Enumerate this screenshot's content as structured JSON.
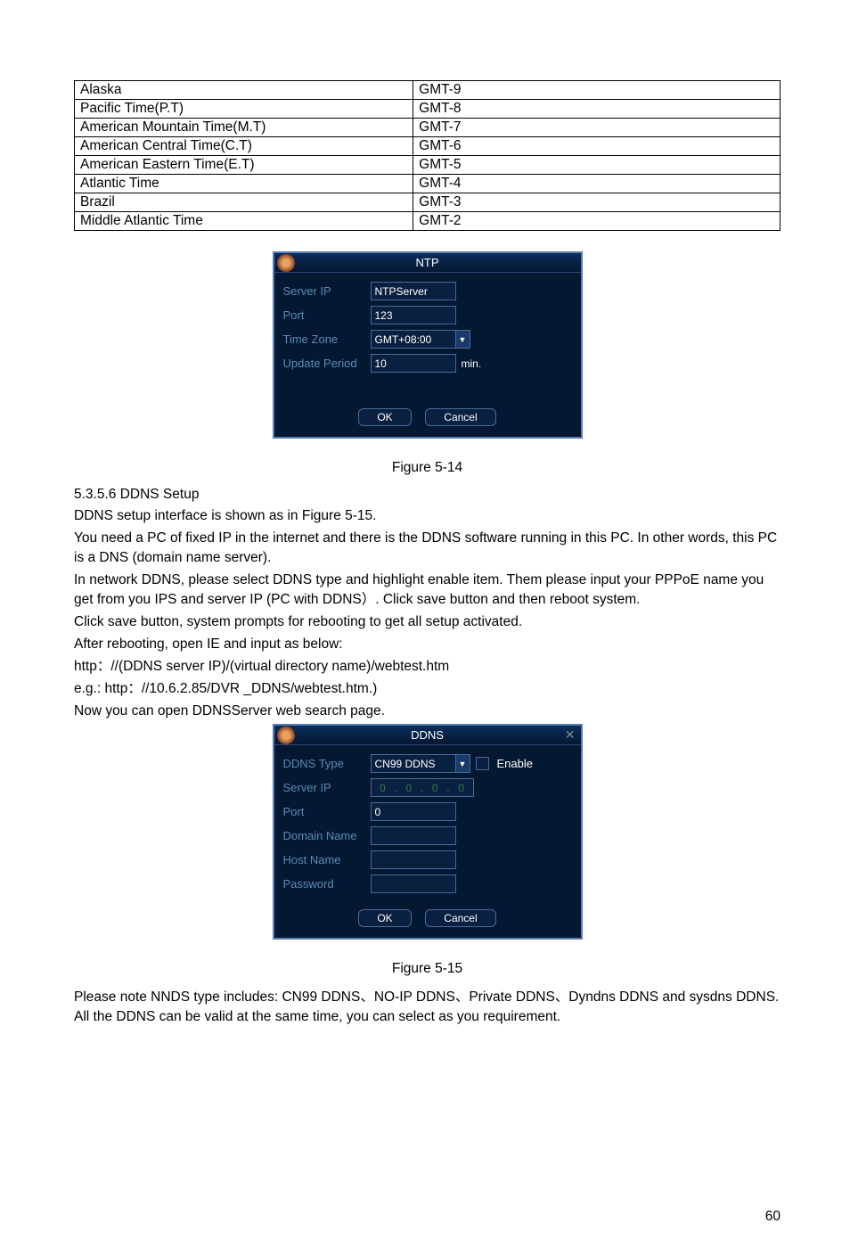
{
  "tz_table": {
    "rows": [
      [
        "Alaska",
        "GMT-9"
      ],
      [
        "Pacific Time(P.T)",
        "GMT-8"
      ],
      [
        "American  Mountain Time(M.T)",
        "GMT-7"
      ],
      [
        "American Central Time(C.T)",
        "GMT-6"
      ],
      [
        "American Eastern Time(E.T)",
        "GMT-5"
      ],
      [
        "Atlantic Time",
        "GMT-4"
      ],
      [
        "Brazil",
        "GMT-3"
      ],
      [
        "Middle Atlantic Time",
        "GMT-2"
      ]
    ]
  },
  "ntp_dialog": {
    "title": "NTP",
    "server_ip_label": "Server IP",
    "server_ip_value": "NTPServer",
    "port_label": "Port",
    "port_value": "123",
    "tz_label": "Time Zone",
    "tz_value": "GMT+08:00",
    "period_label": "Update Period",
    "period_value": "10",
    "period_unit": "min.",
    "ok": "OK",
    "cancel": "Cancel"
  },
  "fig1": "Figure 5-14",
  "section": {
    "heading": "5.3.5.6  DDNS Setup",
    "p1": "DDNS setup interface is shown as in Figure 5-15.",
    "p2": "You need a PC of fixed IP in the internet and there is the DDNS software running in this PC. In other words, this PC is a DNS (domain name server).",
    "p3": "In network DDNS, please select DDNS type and highlight enable item. Them please input your PPPoE name you get from you IPS and server IP (PC with DDNS）. Click save button and then reboot system.",
    "p4": "Click save button, system prompts for rebooting to get all setup activated.",
    "p5": "After rebooting, open IE and input as below:",
    "p6": "http：//(DDNS server IP)/(virtual directory name)/webtest.htm",
    "p7": "e.g.: http：//10.6.2.85/DVR _DDNS/webtest.htm.)",
    "p8": "Now you can open DDNSServer web search page."
  },
  "ddns_dialog": {
    "title": "DDNS",
    "type_label": "DDNS Type",
    "type_value": "CN99 DDNS",
    "enable_label": "Enable",
    "server_ip_label": "Server IP",
    "ip": [
      "0",
      "0",
      "0",
      "0"
    ],
    "port_label": "Port",
    "port_value": "0",
    "domain_label": "Domain Name",
    "host_label": "Host Name",
    "password_label": "Password",
    "ok": "OK",
    "cancel": "Cancel"
  },
  "fig2": "Figure 5-15",
  "footer_text": "Please note NNDS type includes: CN99 DDNS、NO-IP DDNS、Private DDNS、Dyndns DDNS and sysdns DDNS. All the DDNS can be valid at the same time, you can select as you requirement.",
  "page_number": "60"
}
